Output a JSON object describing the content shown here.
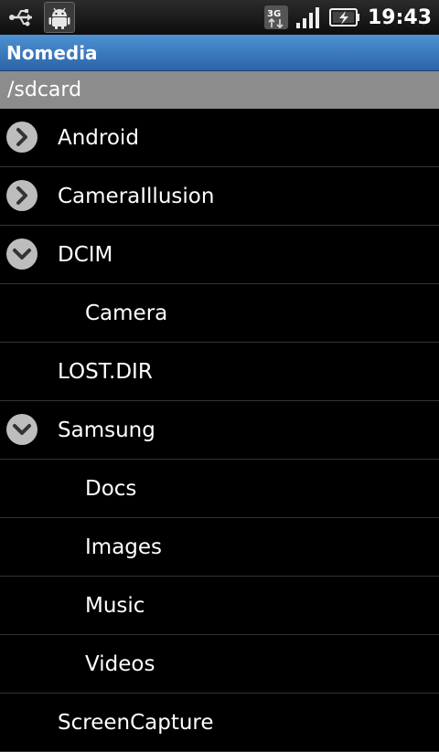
{
  "status_bar": {
    "icons": [
      "usb-icon",
      "android-debug-icon",
      "3g-data-icon",
      "signal-icon",
      "battery-charging-icon"
    ],
    "time": "19:43"
  },
  "app": {
    "title": "Nomedia"
  },
  "path": "/sdcard",
  "folders": [
    {
      "label": "Android",
      "expander": "collapsed"
    },
    {
      "label": "CameraIllusion",
      "expander": "collapsed"
    },
    {
      "label": "DCIM",
      "expander": "expanded"
    },
    {
      "label": "Camera",
      "expander": "none",
      "child": true
    },
    {
      "label": "LOST.DIR",
      "expander": "none"
    },
    {
      "label": "Samsung",
      "expander": "expanded"
    },
    {
      "label": "Docs",
      "expander": "none",
      "child": true
    },
    {
      "label": "Images",
      "expander": "none",
      "child": true
    },
    {
      "label": "Music",
      "expander": "none",
      "child": true
    },
    {
      "label": "Videos",
      "expander": "none",
      "child": true
    },
    {
      "label": "ScreenCapture",
      "expander": "none"
    }
  ],
  "colors": {
    "title_bar": "#3d7cc2",
    "path_bar": "#8c8c8c",
    "list_background": "#000000",
    "text": "#ffffff"
  }
}
